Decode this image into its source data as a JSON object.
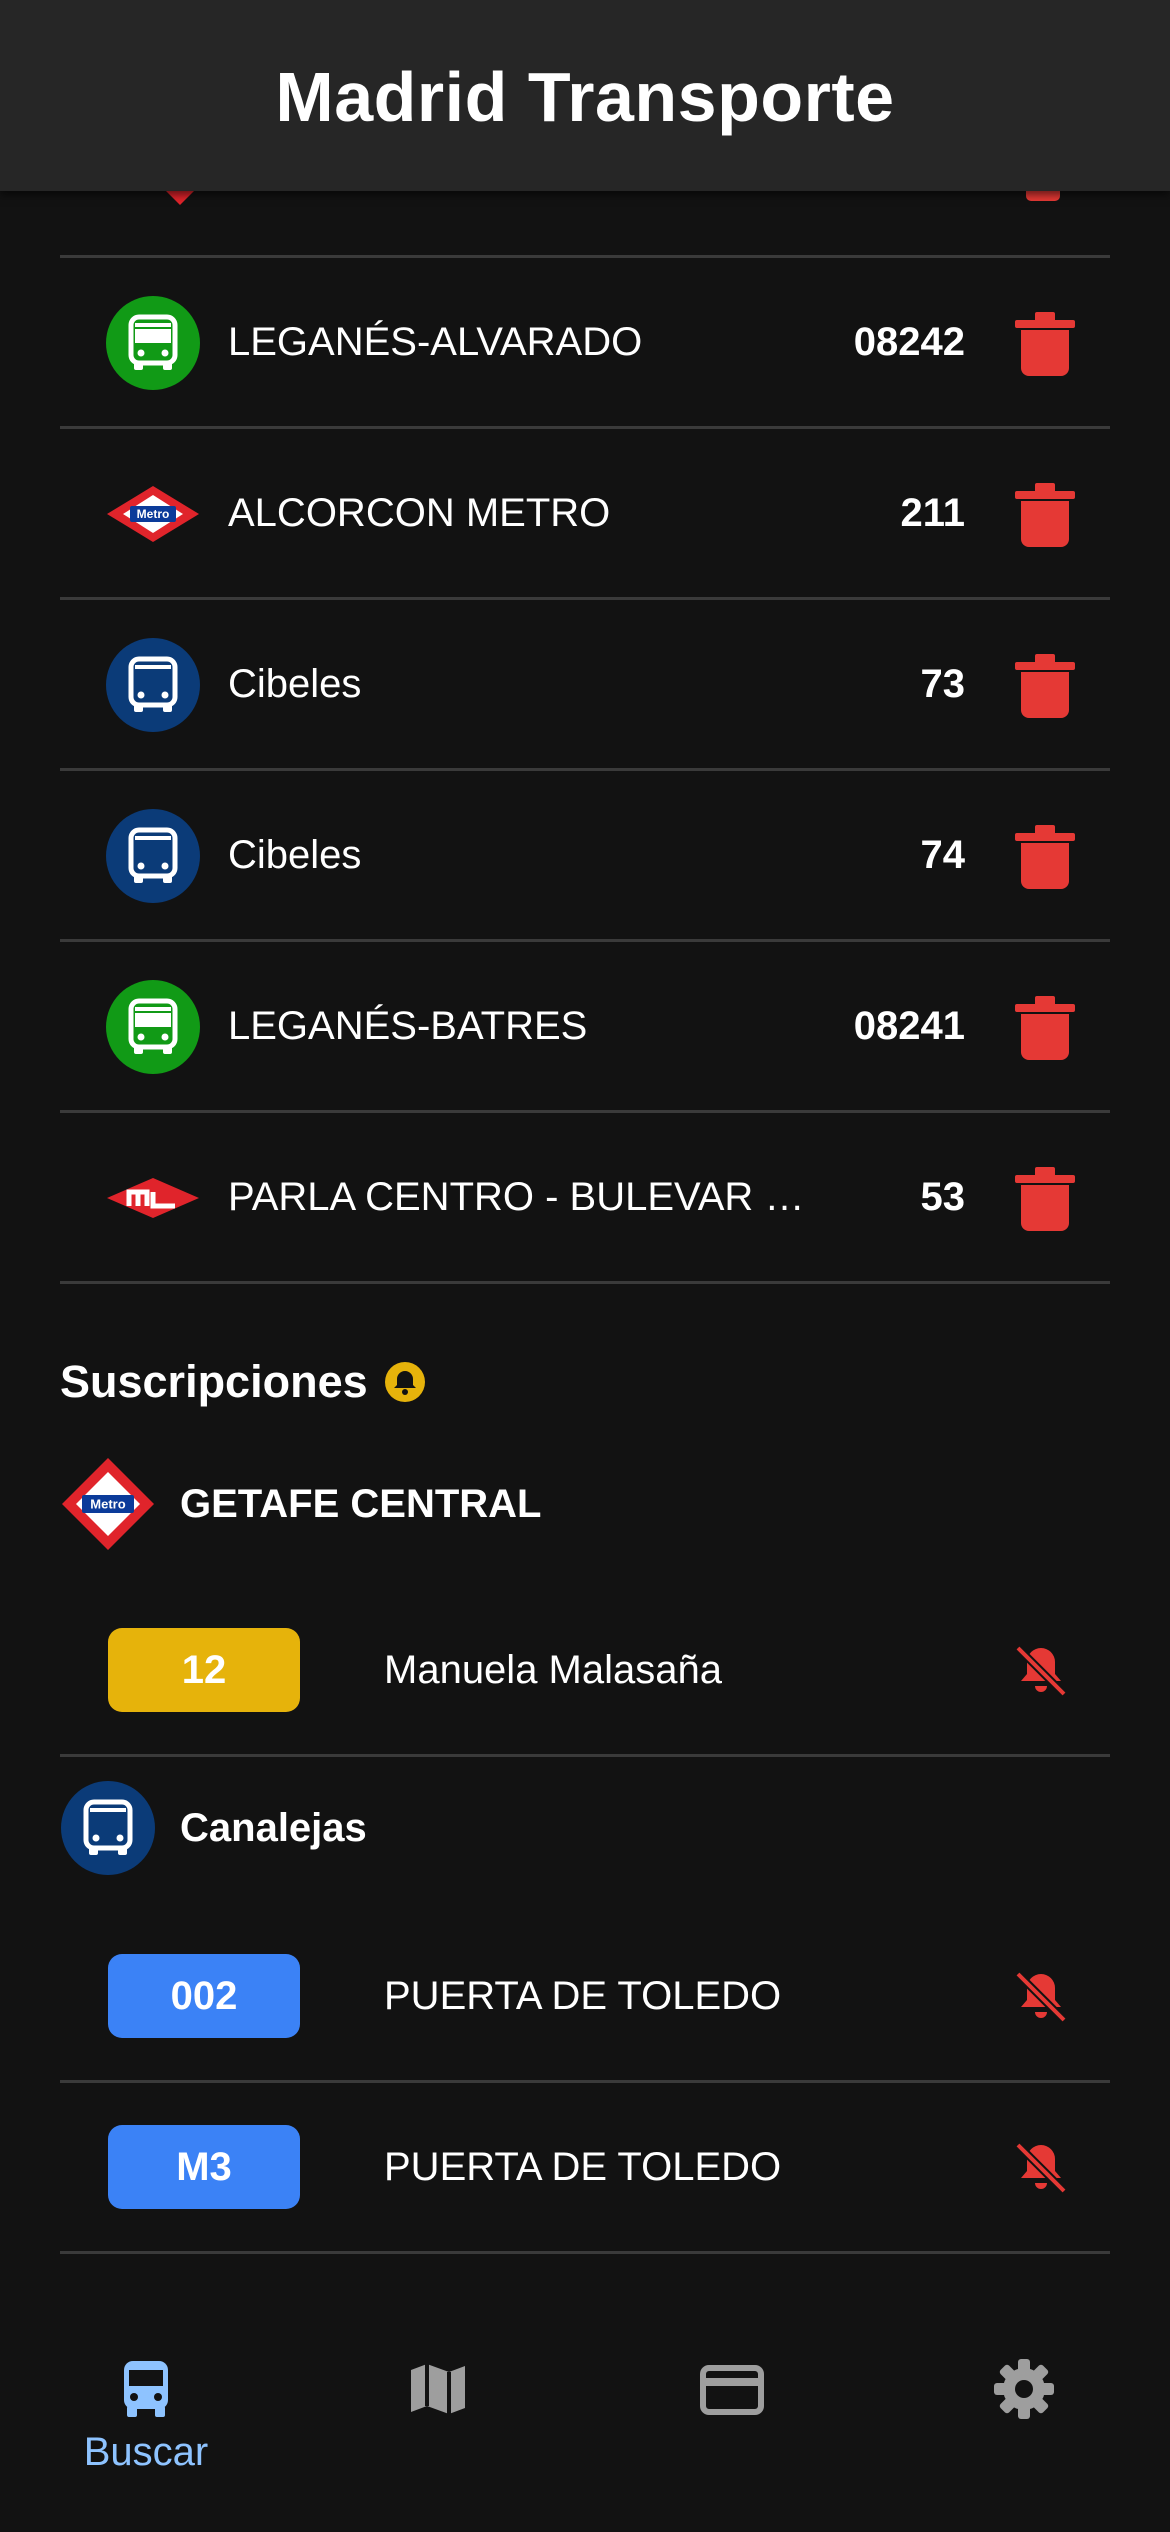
{
  "app": {
    "title": "Madrid Transporte"
  },
  "colors": {
    "accent": "#8ec3ff",
    "danger": "#e53935",
    "gold": "#e6b30b",
    "line_blue": "#3b82f6",
    "emt_blue": "#0b3b78",
    "interurban_green": "#119a16",
    "metro_red": "#e0242b"
  },
  "favorites": [
    {
      "type": "interurban-bus",
      "icon": "green-bus-icon",
      "name": "LEGANÉS-ALVARADO",
      "code": "08242"
    },
    {
      "type": "metro",
      "icon": "metro-logo-icon",
      "name": "ALCORCON METRO",
      "code": "211"
    },
    {
      "type": "emt-bus",
      "icon": "blue-bus-icon",
      "name": "Cibeles",
      "code": "73"
    },
    {
      "type": "emt-bus",
      "icon": "blue-bus-icon",
      "name": "Cibeles",
      "code": "74"
    },
    {
      "type": "interurban-bus",
      "icon": "green-bus-icon",
      "name": "LEGANÉS-BATRES",
      "code": "08241"
    },
    {
      "type": "metro-ligero",
      "icon": "metro-ligero-logo-icon",
      "name": "PARLA CENTRO - BULEVAR NO…",
      "code": "53"
    }
  ],
  "subscriptions": {
    "title": "Suscripciones",
    "stops": [
      {
        "name": "GETAFE CENTRAL",
        "icon": "metro-logo-icon",
        "lines": [
          {
            "line": "12",
            "destination": "Manuela Malasaña",
            "color": "#e6b30b"
          }
        ]
      },
      {
        "name": "Canalejas",
        "icon": "blue-bus-icon",
        "lines": [
          {
            "line": "002",
            "destination": "PUERTA DE TOLEDO",
            "color": "#3b82f6"
          },
          {
            "line": "M3",
            "destination": "PUERTA DE TOLEDO",
            "color": "#3b82f6"
          }
        ]
      }
    ]
  },
  "nav": {
    "items": [
      {
        "label": "Buscar",
        "icon": "bus-icon",
        "active": true
      },
      {
        "label": "",
        "icon": "map-icon",
        "active": false
      },
      {
        "label": "",
        "icon": "card-icon",
        "active": false
      },
      {
        "label": "",
        "icon": "gear-icon",
        "active": false
      }
    ]
  }
}
